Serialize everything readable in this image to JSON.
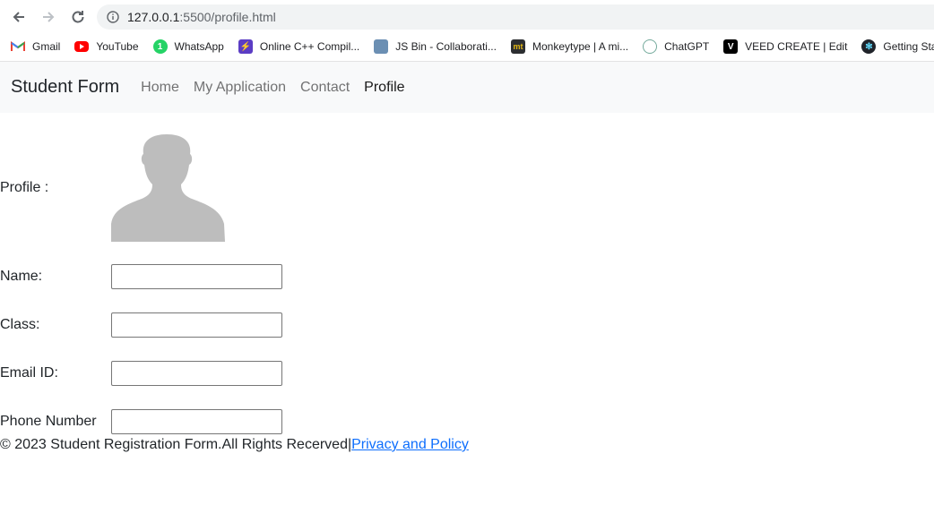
{
  "browser": {
    "url_host": "127.0.0.1",
    "url_path": ":5500/profile.html",
    "bookmarks": [
      {
        "label": "Gmail",
        "icon": "gmail-icon",
        "color": "#EA4335"
      },
      {
        "label": "YouTube",
        "icon": "youtube-icon",
        "color": "#FF0000"
      },
      {
        "label": "WhatsApp",
        "icon": "whatsapp-icon",
        "color": "#25D366"
      },
      {
        "label": "Online C++ Compil...",
        "icon": "lightning-icon",
        "color": "#5B3CC4"
      },
      {
        "label": "JS Bin - Collaborati...",
        "icon": "jsbin-icon",
        "color": "#6b8fb3"
      },
      {
        "label": "Monkeytype | A mi...",
        "icon": "monkeytype-icon",
        "color": "#2c2e31"
      },
      {
        "label": "ChatGPT",
        "icon": "chatgpt-icon",
        "color": "#74aa9c"
      },
      {
        "label": "VEED CREATE | Edit",
        "icon": "veed-icon",
        "color": "#000000"
      },
      {
        "label": "Getting Starte",
        "icon": "react-icon",
        "color": "#20232a"
      }
    ]
  },
  "navbar": {
    "brand": "Student Form",
    "links": [
      "Home",
      "My Application",
      "Contact",
      "Profile"
    ],
    "active": "Profile"
  },
  "form": {
    "profile_label": "Profile :",
    "name_label": "Name:",
    "class_label": "Class:",
    "email_label": "Email ID:",
    "phone_label": "Phone Number",
    "name_value": "",
    "class_value": "",
    "email_value": "",
    "phone_value": ""
  },
  "footer": {
    "text": "© 2023 Student Registration Form.All Rights Recerved|",
    "link": "Privacy and Policy"
  }
}
